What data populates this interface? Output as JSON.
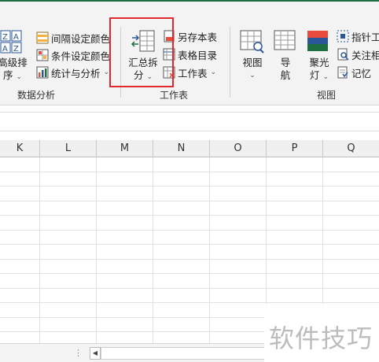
{
  "ribbon": {
    "sort_button": {
      "line1": "高级排",
      "line2": "序",
      "arrow": "⌄"
    },
    "data_analysis": {
      "items": [
        {
          "label": "间隔设定颜色"
        },
        {
          "label": "条件设定颜色"
        },
        {
          "label": "统计与分析",
          "arrow": "⌄"
        }
      ],
      "group_label": "数据分析"
    },
    "worksheet": {
      "summarize_split": {
        "line1": "汇总拆",
        "line2": "分",
        "arrow": "⌄"
      },
      "items": [
        {
          "label": "另存本表"
        },
        {
          "label": "表格目录"
        },
        {
          "label": "工作表",
          "arrow": "⌄"
        }
      ],
      "group_label": "工作表"
    },
    "view": {
      "view_button": {
        "line1": "视图",
        "arrow": "⌄"
      },
      "nav_button": {
        "line1": "导",
        "line2": "航"
      },
      "spotlight_button": {
        "line1": "聚光",
        "line2": "灯",
        "arrow": "⌄"
      },
      "items": [
        {
          "label": "指针工"
        },
        {
          "label": "关注相"
        },
        {
          "label": "记忆"
        }
      ],
      "group_label": "视图"
    }
  },
  "columns": [
    "K",
    "L",
    "M",
    "N",
    "O",
    "P",
    "Q"
  ],
  "statusbar": {
    "dots": "⋮",
    "scroll_left": "◀"
  },
  "watermark": "软件技巧",
  "colors": {
    "accent": "#1d6f42",
    "highlight": "#e0292e"
  }
}
